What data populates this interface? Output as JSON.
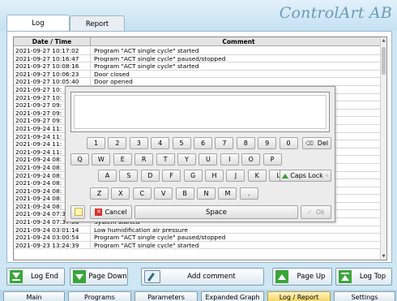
{
  "app": {
    "brand": "ControlArt AB"
  },
  "tabs": {
    "log": "Log",
    "report": "Report"
  },
  "grid": {
    "headers": {
      "date_time": "Date / Time",
      "comment": "Comment"
    },
    "rows": [
      {
        "date": "2021-09-27 10:17:02",
        "comment": "Program \"ACT single cycle\" started"
      },
      {
        "date": "2021-09-27 10:16:47",
        "comment": "Program \"ACT single cycle\" paused/stopped"
      },
      {
        "date": "2021-09-27 10:08:16",
        "comment": "Program \"ACT single cycle\" started"
      },
      {
        "date": "2021-09-27 10:06:23",
        "comment": "Door closed"
      },
      {
        "date": "2021-09-27 10:05:40",
        "comment": "Door opened"
      },
      {
        "date": "2021-09-27 10:",
        "comment": ""
      },
      {
        "date": "2021-09-27 10:",
        "comment": ""
      },
      {
        "date": "2021-09-27 09:",
        "comment": ""
      },
      {
        "date": "2021-09-27 09:",
        "comment": ""
      },
      {
        "date": "2021-09-27 09:",
        "comment": ""
      },
      {
        "date": "2021-09-24 11:",
        "comment": ""
      },
      {
        "date": "2021-09-24 11:",
        "comment": ""
      },
      {
        "date": "2021-09-24 11:",
        "comment": ""
      },
      {
        "date": "2021-09-24 11:",
        "comment": ""
      },
      {
        "date": "2021-09-24 08:",
        "comment": ""
      },
      {
        "date": "2021-09-24 08:",
        "comment": ""
      },
      {
        "date": "2021-09-24 08:",
        "comment": ""
      },
      {
        "date": "2021-09-24 08:",
        "comment": ""
      },
      {
        "date": "2021-09-24 08:",
        "comment": ""
      },
      {
        "date": "2021-09-24 08:",
        "comment": ""
      },
      {
        "date": "2021-09-24 08:",
        "comment": ""
      },
      {
        "date": "2021-09-24 07:37:36",
        "comment": "Program \"ACT single cycle\" started"
      },
      {
        "date": "2021-09-24 07:37:06",
        "comment": "System started"
      },
      {
        "date": "2021-09-24 03:01:14",
        "comment": "Low humidification air pressure"
      },
      {
        "date": "2021-09-24 03:00:54",
        "comment": "Program \"ACT single cycle\" paused/stopped"
      },
      {
        "date": "2021-09-23 13:24:39",
        "comment": "Program \"ACT single cycle\" started"
      }
    ]
  },
  "keyboard": {
    "text_value": "",
    "row1": [
      "1",
      "2",
      "3",
      "4",
      "5",
      "6",
      "7",
      "8",
      "9",
      "0"
    ],
    "del": "Del",
    "row2": [
      "Q",
      "W",
      "E",
      "R",
      "T",
      "Y",
      "U",
      "I",
      "O",
      "P"
    ],
    "row3": [
      "A",
      "S",
      "D",
      "F",
      "G",
      "H",
      "J",
      "K",
      "L"
    ],
    "caps": "Caps Lock",
    "row4": [
      "Z",
      "X",
      "C",
      "V",
      "B",
      "N",
      "M",
      "."
    ],
    "cancel": "Cancel",
    "space": "Space",
    "ok": "Ok"
  },
  "actions": {
    "log_end": "Log End",
    "page_down": "Page Down",
    "add_comment": "Add comment",
    "page_up": "Page Up",
    "log_top": "Log Top"
  },
  "nav": {
    "main": "Main",
    "programs": "Programs",
    "parameters": "Parameters",
    "expanded_graph": "Expanded Graph",
    "log_report": "Log / Report",
    "settings": "Settings"
  }
}
